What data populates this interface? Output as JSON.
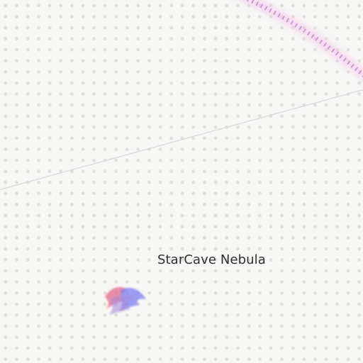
{
  "map": {
    "background_color": "#f7f7f5",
    "dot_color": "#dfe0da",
    "orbit_color": "#c98ad6",
    "orbit_glow_color": "#f3c4ea",
    "path_color": "#dcdcdc"
  },
  "location": {
    "name": "StarCave Nebula",
    "marker_icon": "nebula-icon",
    "marker_colors": [
      "#e06a8e",
      "#7b7ff0",
      "#a88ad8"
    ]
  }
}
